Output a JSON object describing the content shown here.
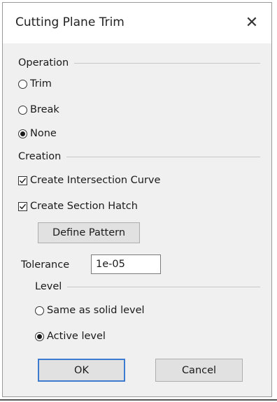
{
  "dialog": {
    "title": "Cutting Plane Trim",
    "close_glyph": "✕"
  },
  "operation": {
    "label": "Operation",
    "options": [
      {
        "label": "Trim",
        "selected": false
      },
      {
        "label": "Break",
        "selected": false
      },
      {
        "label": "None",
        "selected": true
      }
    ]
  },
  "creation": {
    "label": "Creation",
    "checks": [
      {
        "label": "Create Intersection Curve",
        "checked": true
      },
      {
        "label": "Create Section Hatch",
        "checked": true
      }
    ],
    "define_pattern_label": "Define Pattern"
  },
  "tolerance": {
    "label": "Tolerance",
    "value": "1e-05"
  },
  "level": {
    "label": "Level",
    "options": [
      {
        "label": "Same as solid level",
        "selected": false
      },
      {
        "label": "Active level",
        "selected": true
      }
    ]
  },
  "buttons": {
    "ok_label": "OK",
    "cancel_label": "Cancel"
  }
}
